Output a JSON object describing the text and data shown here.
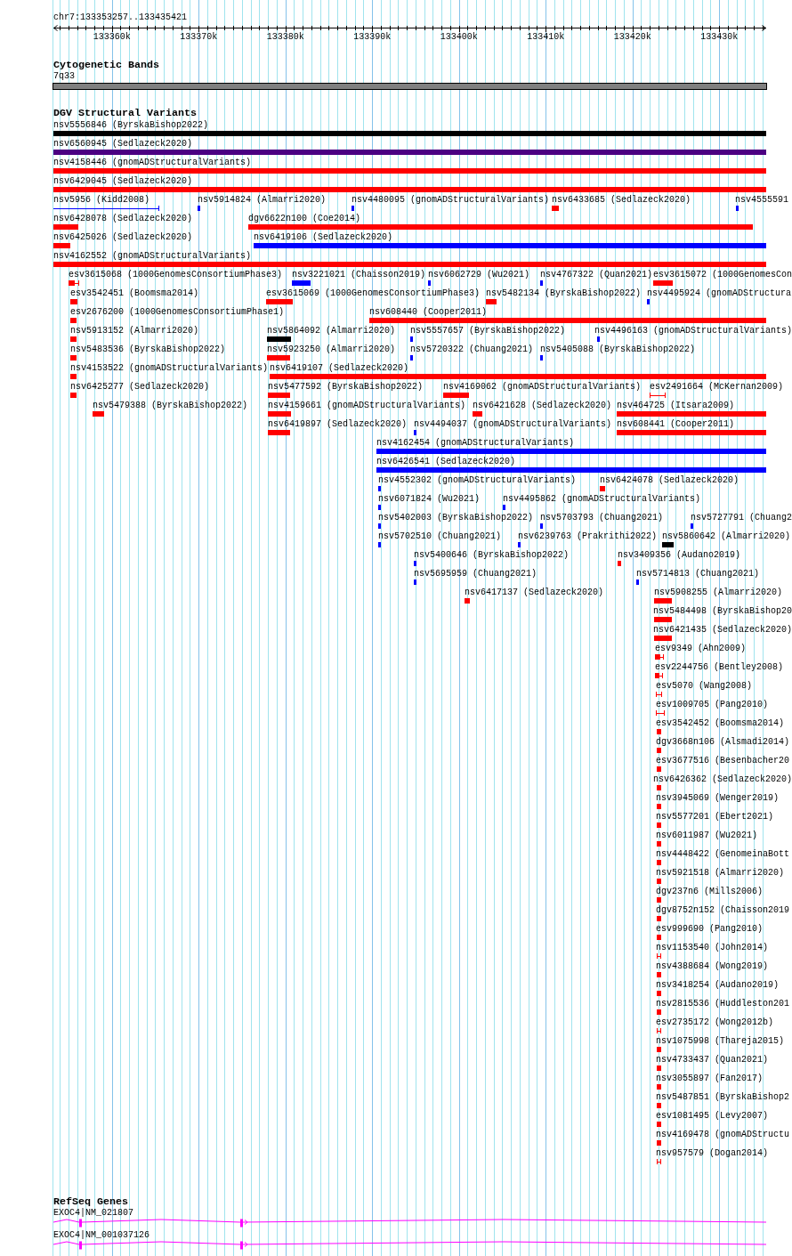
{
  "ruler": {
    "title": "chr7:133353257..133435421",
    "ticks": [
      "133360k",
      "133370k",
      "133380k",
      "133390k",
      "133400k",
      "133410k",
      "133420k",
      "133430k"
    ]
  },
  "cytogenetic_bands": {
    "title": "Cytogenetic Bands",
    "band": "7q33"
  },
  "dgv_structural_variants": {
    "title": "DGV Structural Variants",
    "rows": [
      {
        "features": [
          {
            "label": "nsv5556846 (ByrskaBishop2022)",
            "color": "#000000",
            "kind": "bar"
          }
        ]
      },
      {
        "features": [
          {
            "label": "nsv6560945 (Sedlazeck2020)",
            "color": "#4b0082",
            "kind": "bar"
          }
        ]
      },
      {
        "features": [
          {
            "label": "nsv4158446 (gnomADStructuralVariants)",
            "color": "#ff0000",
            "kind": "bar"
          }
        ]
      },
      {
        "features": [
          {
            "label": "nsv6429045 (Sedlazeck2020)",
            "color": "#ff0000",
            "kind": "bar"
          }
        ]
      },
      {
        "features": [
          {
            "label": "nsv5956 (Kidd2008)",
            "color": "#0000ff",
            "kind": "span"
          },
          {
            "label": "nsv5914824 (Almarri2020)",
            "color": "#0000ff",
            "kind": "bar"
          },
          {
            "label": "nsv4480095 (gnomADStructuralVariants)",
            "color": "#0000ff",
            "kind": "bar"
          },
          {
            "label": "nsv6433685 (Sedlazeck2020)",
            "color": "#ff0000",
            "kind": "bar"
          },
          {
            "label": "nsv4555591",
            "color": "#0000ff",
            "kind": "bar"
          }
        ]
      },
      {
        "features": [
          {
            "label": "nsv6428078 (Sedlazeck2020)",
            "color": "#ff0000",
            "kind": "bar"
          },
          {
            "label": "dgv6622n100 (Coe2014)",
            "color": "#ff0000",
            "kind": "bar"
          }
        ]
      },
      {
        "features": [
          {
            "label": "nsv6425026 (Sedlazeck2020)",
            "color": "#ff0000",
            "kind": "bar"
          },
          {
            "label": "nsv6419106 (Sedlazeck2020)",
            "color": "#0000ff",
            "kind": "bar"
          }
        ]
      },
      {
        "features": [
          {
            "label": "nsv4162552 (gnomADStructuralVariants)",
            "color": "#ff0000",
            "kind": "bar"
          }
        ]
      },
      {
        "features": [
          {
            "label": "esv3615068 (1000GenomesConsortiumPhase3)",
            "color": "#ff0000",
            "kind": "compound"
          },
          {
            "label": "nsv3221021 (Chaisson2019)",
            "color": "#0000ff",
            "kind": "bar"
          },
          {
            "label": "nsv6062729 (Wu2021)",
            "color": "#0000ff",
            "kind": "bar"
          },
          {
            "label": "nsv4767322 (Quan2021)",
            "color": "#0000ff",
            "kind": "bar"
          },
          {
            "label": "esv3615072 (1000GenomesCon",
            "color": "#ff0000",
            "kind": "bar"
          }
        ]
      },
      {
        "features": [
          {
            "label": "esv3542451 (Boomsma2014)",
            "color": "#ff0000",
            "kind": "bar"
          },
          {
            "label": "esv3615069 (1000GenomesConsortiumPhase3)",
            "color": "#ff0000",
            "kind": "bar"
          },
          {
            "label": "nsv5482134 (ByrskaBishop2022)",
            "color": "#ff0000",
            "kind": "bar"
          },
          {
            "label": "nsv4495924 (gnomADStructura",
            "color": "#0000ff",
            "kind": "bar"
          }
        ]
      },
      {
        "features": [
          {
            "label": "esv2676200 (1000GenomesConsortiumPhase1)",
            "color": "#ff0000",
            "kind": "bar"
          },
          {
            "label": "nsv608440 (Cooper2011)",
            "color": "#ff0000",
            "kind": "bar"
          }
        ]
      },
      {
        "features": [
          {
            "label": "nsv5913152 (Almarri2020)",
            "color": "#ff0000",
            "kind": "bar"
          },
          {
            "label": "nsv5864092 (Almarri2020)",
            "color": "#000000",
            "kind": "bar"
          },
          {
            "label": "nsv5557657 (ByrskaBishop2022)",
            "color": "#0000ff",
            "kind": "bar"
          },
          {
            "label": "nsv4496163 (gnomADStructuralVariants)",
            "color": "#0000ff",
            "kind": "bar"
          }
        ]
      },
      {
        "features": [
          {
            "label": "nsv5483536 (ByrskaBishop2022)",
            "color": "#ff0000",
            "kind": "bar"
          },
          {
            "label": "nsv5923250 (Almarri2020)",
            "color": "#ff0000",
            "kind": "bar"
          },
          {
            "label": "nsv5720322 (Chuang2021)",
            "color": "#0000ff",
            "kind": "bar"
          },
          {
            "label": "nsv5405088 (ByrskaBishop2022)",
            "color": "#0000ff",
            "kind": "bar"
          }
        ]
      },
      {
        "features": [
          {
            "label": "nsv4153522 (gnomADStructuralVariants)",
            "color": "#ff0000",
            "kind": "bar"
          },
          {
            "label": "nsv6419107 (Sedlazeck2020)",
            "color": "#ff0000",
            "kind": "bar"
          }
        ]
      },
      {
        "features": [
          {
            "label": "nsv6425277 (Sedlazeck2020)",
            "color": "#ff0000",
            "kind": "bar"
          },
          {
            "label": "nsv5477592 (ByrskaBishop2022)",
            "color": "#ff0000",
            "kind": "bar"
          },
          {
            "label": "nsv4169062 (gnomADStructuralVariants)",
            "color": "#ff0000",
            "kind": "bar"
          },
          {
            "label": "esv2491664 (McKernan2009)",
            "color": "#ff0000",
            "kind": "span"
          }
        ]
      },
      {
        "features": [
          {
            "label": "nsv5479388 (ByrskaBishop2022)",
            "color": "#ff0000",
            "kind": "bar"
          },
          {
            "label": "nsv4159661 (gnomADStructuralVariants)",
            "color": "#ff0000",
            "kind": "bar"
          },
          {
            "label": "nsv6421628 (Sedlazeck2020)",
            "color": "#ff0000",
            "kind": "bar"
          },
          {
            "label": "nsv464725 (Itsara2009)",
            "color": "#ff0000",
            "kind": "bar"
          }
        ]
      },
      {
        "features": [
          {
            "label": "nsv6419897 (Sedlazeck2020)",
            "color": "#ff0000",
            "kind": "bar"
          },
          {
            "label": "nsv4494037 (gnomADStructuralVariants)",
            "color": "#0000ff",
            "kind": "bar"
          },
          {
            "label": "nsv608441 (Cooper2011)",
            "color": "#ff0000",
            "kind": "bar"
          }
        ]
      },
      {
        "features": [
          {
            "label": "nsv4162454 (gnomADStructuralVariants)",
            "color": "#0000ff",
            "kind": "bar"
          }
        ]
      },
      {
        "features": [
          {
            "label": "nsv6426541 (Sedlazeck2020)",
            "color": "#0000ff",
            "kind": "bar"
          }
        ]
      },
      {
        "features": [
          {
            "label": "nsv4552302 (gnomADStructuralVariants)",
            "color": "#0000ff",
            "kind": "bar"
          },
          {
            "label": "nsv6424078 (Sedlazeck2020)",
            "color": "#ff0000",
            "kind": "bar"
          }
        ]
      },
      {
        "features": [
          {
            "label": "nsv6071824 (Wu2021)",
            "color": "#0000ff",
            "kind": "bar"
          },
          {
            "label": "nsv4495862 (gnomADStructuralVariants)",
            "color": "#0000ff",
            "kind": "bar"
          }
        ]
      },
      {
        "features": [
          {
            "label": "nsv5402003 (ByrskaBishop2022)",
            "color": "#0000ff",
            "kind": "bar"
          },
          {
            "label": "nsv5703793 (Chuang2021)",
            "color": "#0000ff",
            "kind": "bar"
          },
          {
            "label": "nsv5727791 (Chuang2",
            "color": "#0000ff",
            "kind": "bar"
          }
        ]
      },
      {
        "features": [
          {
            "label": "nsv5702510 (Chuang2021)",
            "color": "#0000ff",
            "kind": "bar"
          },
          {
            "label": "nsv6239763 (Prakrithi2022)",
            "color": "#0000ff",
            "kind": "bar"
          },
          {
            "label": "nsv5860642 (Almarri2020)",
            "color": "#000000",
            "kind": "bar"
          }
        ]
      },
      {
        "features": [
          {
            "label": "nsv5400646 (ByrskaBishop2022)",
            "color": "#0000ff",
            "kind": "bar"
          },
          {
            "label": "nsv3409356 (Audano2019)",
            "color": "#ff0000",
            "kind": "bar"
          }
        ]
      },
      {
        "features": [
          {
            "label": "nsv5695959 (Chuang2021)",
            "color": "#0000ff",
            "kind": "bar"
          },
          {
            "label": "nsv5714813 (Chuang2021)",
            "color": "#0000ff",
            "kind": "bar"
          }
        ]
      },
      {
        "features": [
          {
            "label": "nsv6417137 (Sedlazeck2020)",
            "color": "#ff0000",
            "kind": "bar"
          },
          {
            "label": "nsv5908255 (Almarri2020)",
            "color": "#ff0000",
            "kind": "bar"
          }
        ]
      },
      {
        "features": [
          {
            "label": "nsv5484498 (ByrskaBishop20",
            "color": "#ff0000",
            "kind": "bar"
          }
        ]
      },
      {
        "features": [
          {
            "label": "nsv6421435 (Sedlazeck2020)",
            "color": "#ff0000",
            "kind": "bar"
          }
        ]
      },
      {
        "features": [
          {
            "label": "esv9349 (Ahn2009)",
            "color": "#ff0000",
            "kind": "compound"
          }
        ]
      },
      {
        "features": [
          {
            "label": "esv2244756 (Bentley2008)",
            "color": "#ff0000",
            "kind": "compound"
          }
        ]
      },
      {
        "features": [
          {
            "label": "esv5070 (Wang2008)",
            "color": "#ff0000",
            "kind": "span"
          }
        ]
      },
      {
        "features": [
          {
            "label": "esv1009705 (Pang2010)",
            "color": "#ff0000",
            "kind": "span"
          }
        ]
      },
      {
        "features": [
          {
            "label": "esv3542452 (Boomsma2014)",
            "color": "#ff0000",
            "kind": "bar"
          }
        ]
      },
      {
        "features": [
          {
            "label": "dgv3668n106 (Alsmadi2014)",
            "color": "#ff0000",
            "kind": "bar"
          }
        ]
      },
      {
        "features": [
          {
            "label": "esv3677516 (Besenbacher20",
            "color": "#ff0000",
            "kind": "bar"
          }
        ]
      },
      {
        "features": [
          {
            "label": "nsv6426362 (Sedlazeck2020)",
            "color": "#ff0000",
            "kind": "bar"
          }
        ]
      },
      {
        "features": [
          {
            "label": "nsv3945069 (Wenger2019)",
            "color": "#ff0000",
            "kind": "bar"
          }
        ]
      },
      {
        "features": [
          {
            "label": "nsv5577201 (Ebert2021)",
            "color": "#ff0000",
            "kind": "bar"
          }
        ]
      },
      {
        "features": [
          {
            "label": "nsv6011987 (Wu2021)",
            "color": "#ff0000",
            "kind": "bar"
          }
        ]
      },
      {
        "features": [
          {
            "label": "nsv4448422 (GenomeinaBott",
            "color": "#ff0000",
            "kind": "bar"
          }
        ]
      },
      {
        "features": [
          {
            "label": "nsv5921518 (Almarri2020)",
            "color": "#ff0000",
            "kind": "bar"
          }
        ]
      },
      {
        "features": [
          {
            "label": "dgv237n6 (Mills2006)",
            "color": "#ff0000",
            "kind": "bar"
          }
        ]
      },
      {
        "features": [
          {
            "label": "dgv8752n152 (Chaisson2019",
            "color": "#ff0000",
            "kind": "bar"
          }
        ]
      },
      {
        "features": [
          {
            "label": "esv999690 (Pang2010)",
            "color": "#ff0000",
            "kind": "bar"
          }
        ]
      },
      {
        "features": [
          {
            "label": "nsv1153540 (John2014)",
            "color": "#ff0000",
            "kind": "span"
          }
        ]
      },
      {
        "features": [
          {
            "label": "nsv4388684 (Wong2019)",
            "color": "#ff0000",
            "kind": "bar"
          }
        ]
      },
      {
        "features": [
          {
            "label": "nsv3418254 (Audano2019)",
            "color": "#ff0000",
            "kind": "bar"
          }
        ]
      },
      {
        "features": [
          {
            "label": "nsv2815536 (Huddleston201",
            "color": "#ff0000",
            "kind": "bar"
          }
        ]
      },
      {
        "features": [
          {
            "label": "esv2735172 (Wong2012b)",
            "color": "#ff0000",
            "kind": "span"
          }
        ]
      },
      {
        "features": [
          {
            "label": "nsv1075998 (Thareja2015)",
            "color": "#ff0000",
            "kind": "bar"
          }
        ]
      },
      {
        "features": [
          {
            "label": "nsv4733437 (Quan2021)",
            "color": "#ff0000",
            "kind": "bar"
          }
        ]
      },
      {
        "features": [
          {
            "label": "nsv3055897 (Fan2017)",
            "color": "#ff0000",
            "kind": "bar"
          }
        ]
      },
      {
        "features": [
          {
            "label": "nsv5487851 (ByrskaBishop2",
            "color": "#ff0000",
            "kind": "bar"
          }
        ]
      },
      {
        "features": [
          {
            "label": "esv1081495 (Levy2007)",
            "color": "#ff0000",
            "kind": "bar"
          }
        ]
      },
      {
        "features": [
          {
            "label": "nsv4169478 (gnomADStructu",
            "color": "#ff0000",
            "kind": "bar"
          }
        ]
      },
      {
        "features": [
          {
            "label": "nsv957579 (Dogan2014)",
            "color": "#ff0000",
            "kind": "span"
          }
        ]
      }
    ]
  },
  "refseq_genes": {
    "title": "RefSeq Genes",
    "transcripts": [
      {
        "label": "EXOC4|NM_021807"
      },
      {
        "label": "EXOC4|NM_001037126"
      }
    ]
  }
}
